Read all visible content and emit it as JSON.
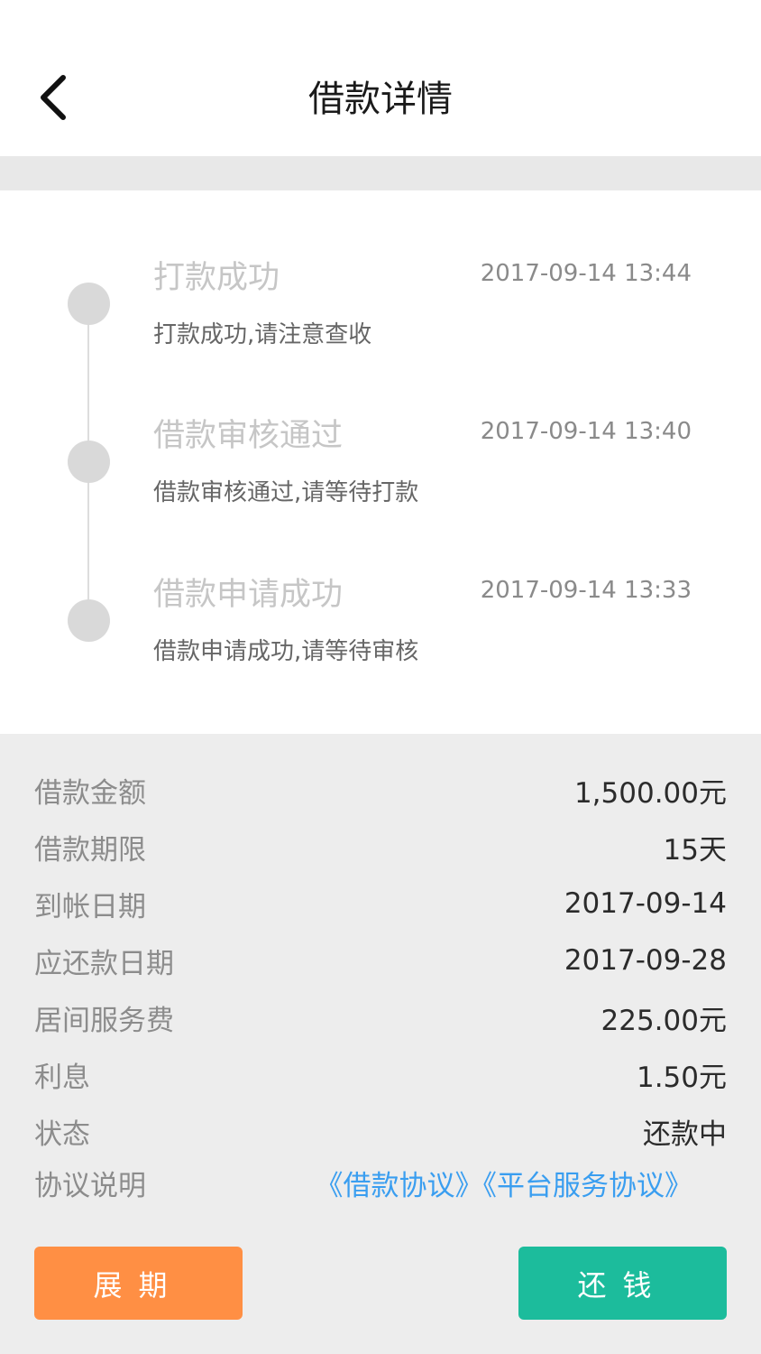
{
  "header": {
    "title": "借款详情"
  },
  "timeline": [
    {
      "title": "打款成功",
      "time": "2017-09-14 13:44",
      "desc": "打款成功,请注意查收"
    },
    {
      "title": "借款审核通过",
      "time": "2017-09-14 13:40",
      "desc": "借款审核通过,请等待打款"
    },
    {
      "title": "借款申请成功",
      "time": "2017-09-14 13:33",
      "desc": "借款申请成功,请等待审核"
    }
  ],
  "details": {
    "amount": {
      "label": "借款金额",
      "value": "1,500.00元"
    },
    "term": {
      "label": "借款期限",
      "value": "15天"
    },
    "arrival_date": {
      "label": "到帐日期",
      "value": "2017-09-14"
    },
    "due_date": {
      "label": "应还款日期",
      "value": "2017-09-28"
    },
    "service_fee": {
      "label": "居间服务费",
      "value": "225.00元"
    },
    "interest": {
      "label": "利息",
      "value": "1.50元"
    },
    "status": {
      "label": "状态",
      "value": "还款中"
    },
    "agreement": {
      "label": "协议说明",
      "links": [
        "《借款协议》",
        "《平台服务协议》"
      ]
    }
  },
  "actions": {
    "extend_label": "展期",
    "repay_label": "还钱"
  },
  "colors": {
    "extend": "#ff8f44",
    "repay": "#1cbc9c",
    "link": "#3a9ef0"
  },
  "icons": {
    "back": "chevron-left-icon",
    "timeline_dot": "circle-icon"
  }
}
